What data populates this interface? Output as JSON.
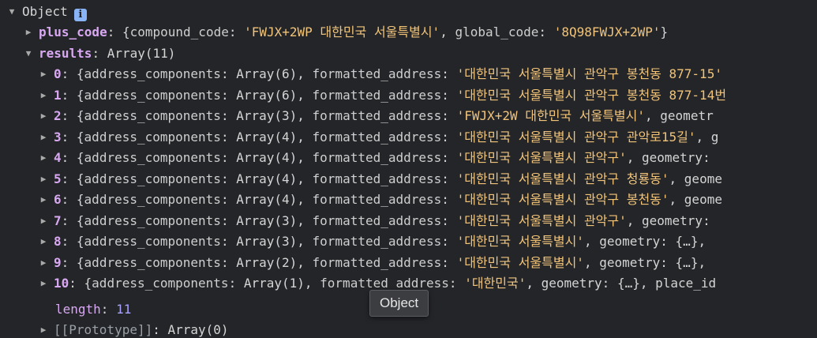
{
  "console": {
    "root": {
      "label": "Object",
      "info_icon": "i"
    },
    "plus_code": {
      "key": "plus_code",
      "open": "{",
      "k1": "compound_code",
      "v1": "'FWJX+2WP 대한민국 서울특별시'",
      "k2": "global_code",
      "v2": "'8Q98FWJX+2WP'",
      "close": "}"
    },
    "results": {
      "key": "results",
      "value": "Array(11)"
    },
    "items": [
      {
        "index": "0",
        "components": "Array(6)",
        "address": "'대한민국 서울특별시 관악구 봉천동 877-15'",
        "rest": ""
      },
      {
        "index": "1",
        "components": "Array(6)",
        "address": "'대한민국 서울특별시 관악구 봉천동 877-14번",
        "rest": ""
      },
      {
        "index": "2",
        "components": "Array(3)",
        "address": "'FWJX+2W 대한민국 서울특별시'",
        "rest": ", geometr"
      },
      {
        "index": "3",
        "components": "Array(4)",
        "address": "'대한민국 서울특별시 관악구 관악로15길'",
        "rest": ", g"
      },
      {
        "index": "4",
        "components": "Array(4)",
        "address": "'대한민국 서울특별시 관악구'",
        "rest": ", geometry: "
      },
      {
        "index": "5",
        "components": "Array(4)",
        "address": "'대한민국 서울특별시 관악구 청룡동'",
        "rest": ", geome"
      },
      {
        "index": "6",
        "components": "Array(4)",
        "address": "'대한민국 서울특별시 관악구 봉천동'",
        "rest": ", geome"
      },
      {
        "index": "7",
        "components": "Array(3)",
        "address": "'대한민국 서울특별시 관악구'",
        "rest": ", geometry: "
      },
      {
        "index": "8",
        "components": "Array(3)",
        "address": "'대한민국 서울특별시'",
        "rest": ", geometry: {…}, "
      },
      {
        "index": "9",
        "components": "Array(2)",
        "address": "'대한민국 서울특별시'",
        "rest": ", geometry: {…}, "
      },
      {
        "index": "10",
        "components": "Array(1)",
        "address": "'대한민국'",
        "rest": ", geometry: {…}, place_id"
      }
    ],
    "labels": {
      "address_components": "address_components",
      "formatted_address": "formatted_address"
    },
    "length": {
      "key": "length",
      "value": "11"
    },
    "prototype": {
      "key": "[[Prototype]]",
      "value": "Array(0)"
    }
  },
  "tooltip": {
    "text": "Object"
  }
}
